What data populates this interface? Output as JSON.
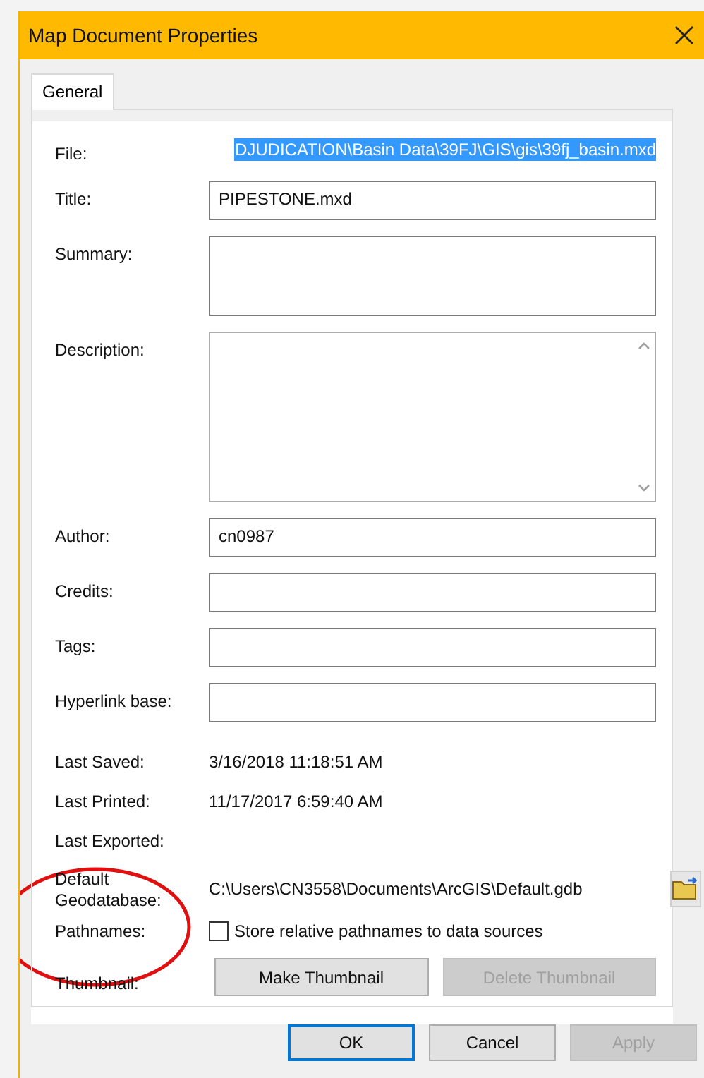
{
  "window": {
    "title": "Map Document Properties"
  },
  "tabs": [
    {
      "label": "General",
      "selected": true
    }
  ],
  "fields": [
    {
      "label": "File:",
      "kind": "selected-text",
      "value": "DJUDICATION\\Basin Data\\39FJ\\GIS\\gis\\39fj_basin.mxd"
    },
    {
      "label": "Title:",
      "kind": "input",
      "value": "PIPESTONE.mxd"
    },
    {
      "label": "Summary:",
      "kind": "textarea"
    },
    {
      "label": "Description:",
      "kind": "scroll-textarea"
    },
    {
      "label": "Author:",
      "kind": "input",
      "value": "cn0987"
    },
    {
      "label": "Credits:",
      "kind": "input"
    },
    {
      "label": "Tags:",
      "kind": "input"
    },
    {
      "label": "Hyperlink base:",
      "kind": "input"
    }
  ],
  "info": [
    {
      "label": "Last Saved:",
      "value": "3/16/2018 11:18:51 AM"
    },
    {
      "label": "Last Printed:",
      "value": "11/17/2017 6:59:40 AM"
    },
    {
      "label": "Last Exported:"
    }
  ],
  "geodatabase": {
    "label": "Default Geodatabase:",
    "path": "C:\\Users\\CN3558\\Documents\\ArcGIS\\Default.gdb"
  },
  "pathnames": {
    "label": "Pathnames:",
    "checkbox_label": "Store relative pathnames to data sources",
    "checked": false
  },
  "thumbnail": {
    "label": "Thumbnail:",
    "buttons": [
      {
        "label": "Make Thumbnail",
        "disabled": false
      },
      {
        "label": "Delete Thumbnail",
        "disabled": true
      }
    ]
  },
  "footer_buttons": [
    {
      "label": "OK",
      "default": true,
      "disabled": false
    },
    {
      "label": "Cancel",
      "default": false,
      "disabled": false
    },
    {
      "label": "Apply",
      "default": false,
      "disabled": true
    }
  ]
}
